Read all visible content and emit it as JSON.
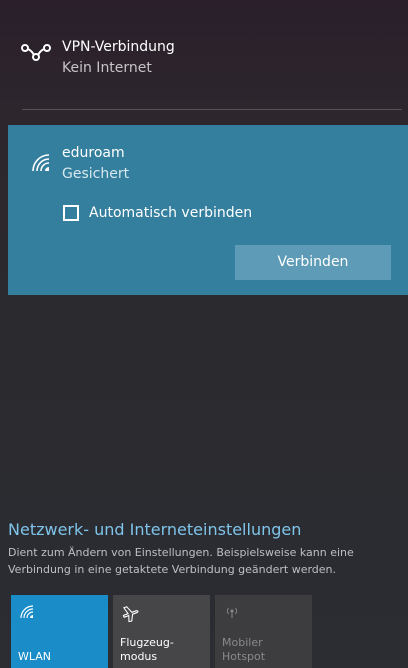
{
  "vpn": {
    "icon": "vpn-icon",
    "title": "VPN-Verbindung",
    "status": "Kein Internet"
  },
  "network": {
    "icon": "wifi-icon",
    "name": "eduroam",
    "status": "Gesichert",
    "auto_connect_label": "Automatisch verbinden",
    "auto_connect_checked": false,
    "connect_label": "Verbinden"
  },
  "settings": {
    "link_text": "Netzwerk- und Interneteinstellungen",
    "description": "Dient zum Ändern von Einstellungen. Beispielsweise kann eine Verbindung in eine getaktete Verbindung geändert werden."
  },
  "tiles": [
    {
      "label": "WLAN",
      "icon": "wifi-icon",
      "active": true
    },
    {
      "label": "Flugzeug-\nmodus",
      "icon": "airplane-icon",
      "active": false
    },
    {
      "label": "Mobiler\nHotspot",
      "icon": "hotspot-icon",
      "active": false,
      "disabled": true
    }
  ],
  "colors": {
    "accent": "#1a8dc8",
    "selected_panel": "#347f9e",
    "connect_button": "#5d9bb6",
    "link": "#7fc4ea"
  }
}
